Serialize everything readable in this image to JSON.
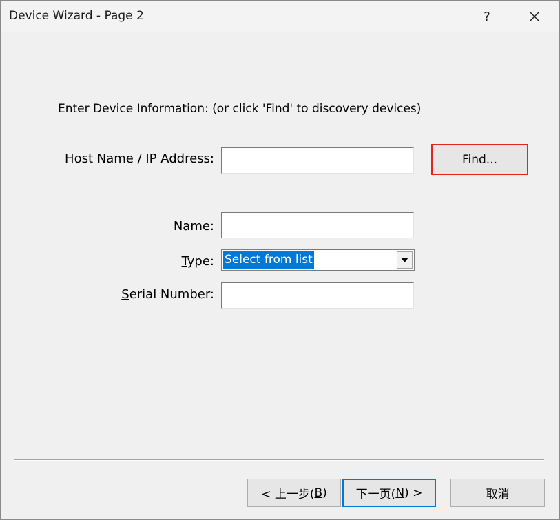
{
  "window": {
    "title": "Device Wizard - Page 2",
    "help_label": "?",
    "close_icon": "close-icon"
  },
  "main": {
    "instruction": "Enter Device Information: (or click 'Find' to discovery devices)",
    "host": {
      "label": "Host Name / IP Address:",
      "value": ""
    },
    "find_label": "Find...",
    "name": {
      "label": "Name:",
      "value": ""
    },
    "type": {
      "label_pre": "",
      "label_accel": "T",
      "label_post": "ype:",
      "selected": "Select from list"
    },
    "serial": {
      "label_accel": "S",
      "label_post": "erial Number:",
      "value": ""
    }
  },
  "footer": {
    "back": {
      "pre": "< 上一步(",
      "accel": "B",
      "post": ")"
    },
    "next": {
      "pre": "下一页(",
      "accel": "N",
      "post": ") >"
    },
    "cancel": "取消"
  },
  "colors": {
    "highlight": "#e0251b",
    "selection": "#0078d7"
  }
}
